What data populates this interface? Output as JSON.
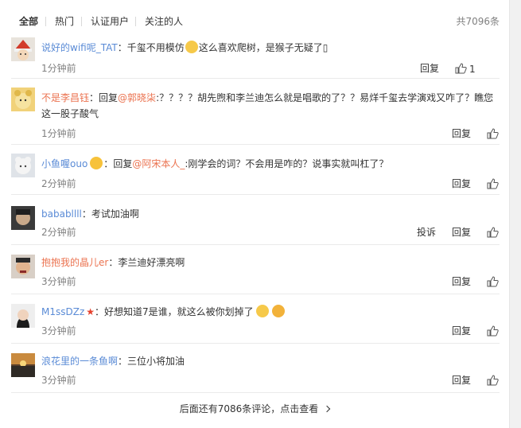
{
  "tabs": [
    "全部",
    "热门",
    "认证用户",
    "关注的人"
  ],
  "total_count": "共7096条",
  "reply_label": "回复",
  "report_label": "投诉",
  "comments": [
    {
      "user": "说好的wifi呢_TAT",
      "sep": "：",
      "text_before": "千玺不用模仿",
      "text_after": "这么喜欢爬树，是猴子无疑了▯",
      "time": "1分钟前",
      "likes": "1"
    },
    {
      "user": "不是李昌钰",
      "sep": "：",
      "reply_prefix": "回复",
      "mention": "@郭晓柒",
      "text": ":？？？？胡先煦和李兰迪怎么就是唱歌的了？？易烊千玺去学演戏又咋了？瞧您这一股子酸气",
      "time": "1分钟前"
    },
    {
      "user": "小鱼喔ouo",
      "sep": "：",
      "reply_prefix": "回复",
      "mention": "@阿宋本人_",
      "text": ":刚学会的词？不会用是咋的？说事实就叫杠了？",
      "time": "2分钟前"
    },
    {
      "user": "bababllll",
      "sep": "：",
      "text": "考试加油啊",
      "time": "2分钟前"
    },
    {
      "user": "抱抱我的晶儿er",
      "sep": "：",
      "text": "李兰迪好漂亮啊",
      "time": "3分钟前"
    },
    {
      "user": "M1ssDZz",
      "sep": "：",
      "text": "好想知道7是谁，就这么被你划掉了",
      "time": "3分钟前"
    },
    {
      "user": "浪花里的一条鱼啊",
      "sep": "：",
      "text": "三位小将加油",
      "time": "3分钟前"
    }
  ],
  "more_text": "后面还有7086条评论，点击查看"
}
